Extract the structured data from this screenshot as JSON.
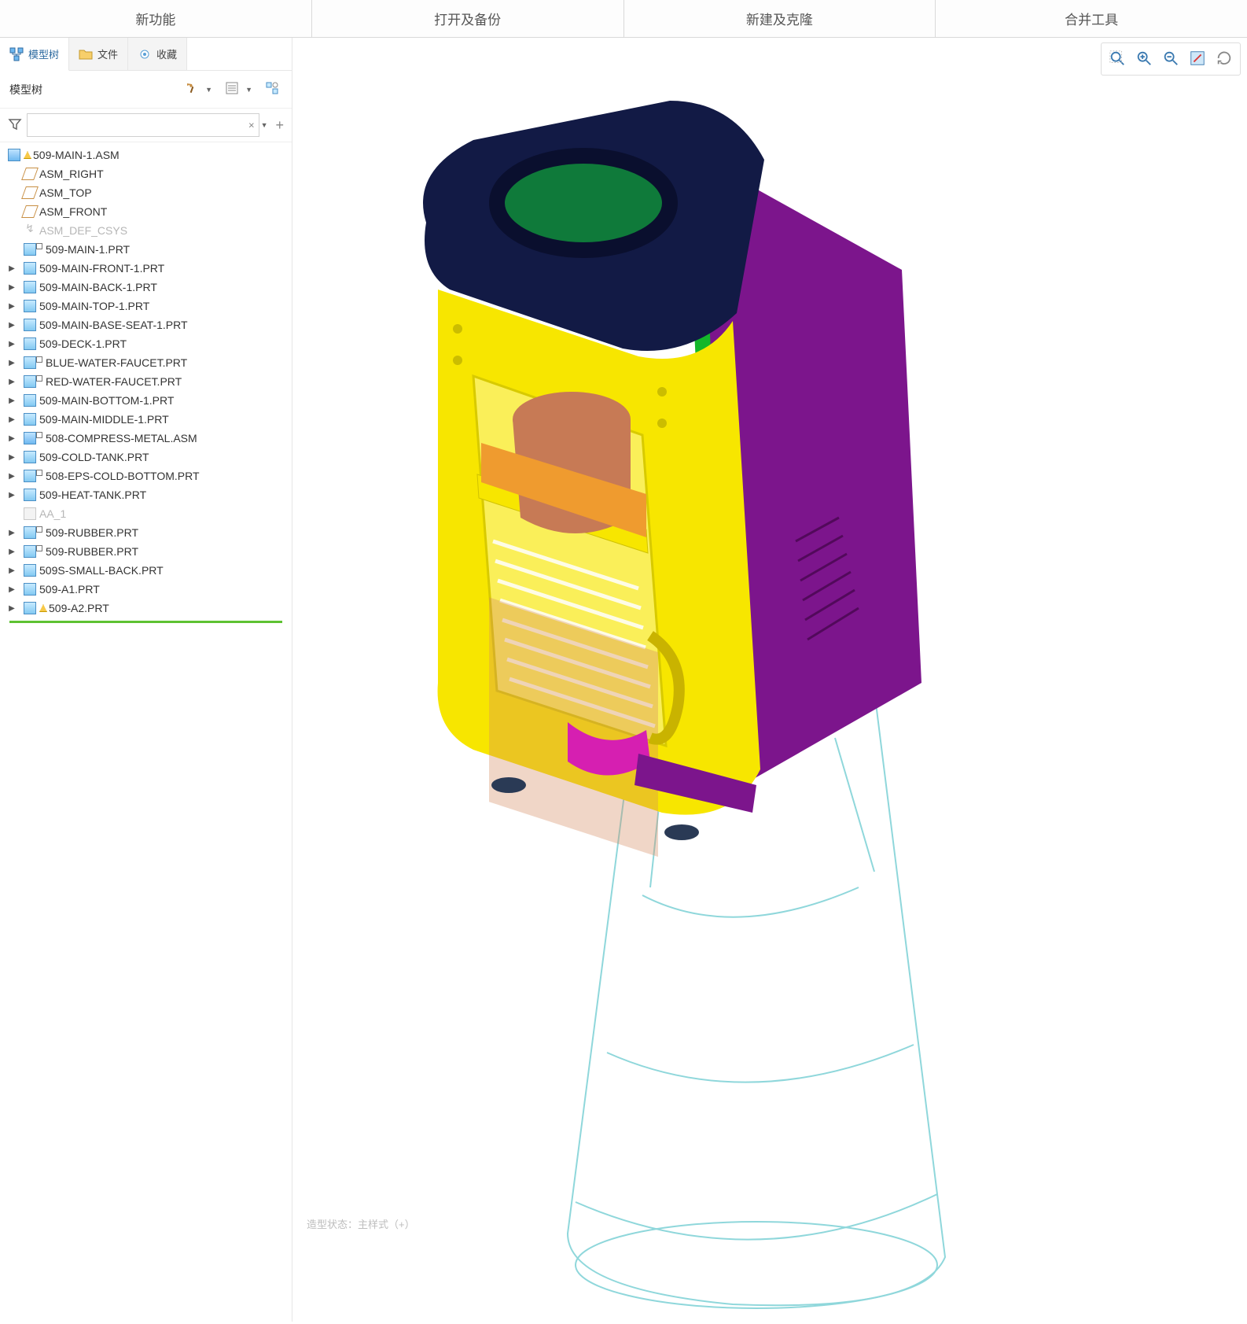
{
  "ribbon": {
    "items": [
      {
        "label": "新功能"
      },
      {
        "label": "打开及备份"
      },
      {
        "label": "新建及克隆"
      },
      {
        "label": "合并工具"
      }
    ]
  },
  "sidebar": {
    "tabs": [
      {
        "label": "模型树",
        "active": true
      },
      {
        "label": "文件",
        "active": false
      },
      {
        "label": "收藏",
        "active": false
      }
    ],
    "toolbar_label": "模型树",
    "filter": {
      "value": "",
      "placeholder": ""
    },
    "tree": {
      "root": {
        "label": "509-MAIN-1.ASM",
        "icon": "asm",
        "warn": true
      },
      "children": [
        {
          "label": "ASM_RIGHT",
          "icon": "plane",
          "expandable": false
        },
        {
          "label": "ASM_TOP",
          "icon": "plane",
          "expandable": false
        },
        {
          "label": "ASM_FRONT",
          "icon": "plane",
          "expandable": false
        },
        {
          "label": "ASM_DEF_CSYS",
          "icon": "csys",
          "dim": true,
          "expandable": false
        },
        {
          "label": "509-MAIN-1.PRT",
          "icon": "prt",
          "overlay": true,
          "expandable": false
        },
        {
          "label": "509-MAIN-FRONT-1.PRT",
          "icon": "prt",
          "expandable": true
        },
        {
          "label": "509-MAIN-BACK-1.PRT",
          "icon": "prt",
          "expandable": true
        },
        {
          "label": "509-MAIN-TOP-1.PRT",
          "icon": "prt",
          "expandable": true
        },
        {
          "label": "509-MAIN-BASE-SEAT-1.PRT",
          "icon": "prt",
          "expandable": true
        },
        {
          "label": "509-DECK-1.PRT",
          "icon": "prt",
          "expandable": true
        },
        {
          "label": "BLUE-WATER-FAUCET.PRT",
          "icon": "prt",
          "overlay": true,
          "expandable": true
        },
        {
          "label": "RED-WATER-FAUCET.PRT",
          "icon": "prt",
          "overlay": true,
          "expandable": true
        },
        {
          "label": "509-MAIN-BOTTOM-1.PRT",
          "icon": "prt",
          "expandable": true
        },
        {
          "label": "509-MAIN-MIDDLE-1.PRT",
          "icon": "prt",
          "expandable": true
        },
        {
          "label": "508-COMPRESS-METAL.ASM",
          "icon": "asm",
          "overlay": true,
          "expandable": true
        },
        {
          "label": "509-COLD-TANK.PRT",
          "icon": "prt",
          "expandable": true
        },
        {
          "label": "508-EPS-COLD-BOTTOM.PRT",
          "icon": "prt",
          "overlay": true,
          "expandable": true
        },
        {
          "label": "509-HEAT-TANK.PRT",
          "icon": "prt",
          "expandable": true
        },
        {
          "label": "AA_1",
          "icon": "note",
          "dim": true,
          "expandable": false
        },
        {
          "label": "509-RUBBER.PRT",
          "icon": "prt",
          "overlay": true,
          "expandable": true
        },
        {
          "label": "509-RUBBER.PRT",
          "icon": "prt",
          "overlay": true,
          "expandable": true
        },
        {
          "label": "509S-SMALL-BACK.PRT",
          "icon": "prt",
          "expandable": true
        },
        {
          "label": "509-A1.PRT",
          "icon": "prt",
          "expandable": true
        },
        {
          "label": "509-A2.PRT",
          "icon": "prt",
          "warn": true,
          "expandable": true
        }
      ]
    }
  },
  "canvas": {
    "status_text": "造型状态：主样式（+）",
    "view_tools": [
      {
        "name": "zoom-fit-icon"
      },
      {
        "name": "zoom-in-icon"
      },
      {
        "name": "zoom-out-icon"
      },
      {
        "name": "pan-icon"
      },
      {
        "name": "rotate-icon"
      }
    ]
  }
}
